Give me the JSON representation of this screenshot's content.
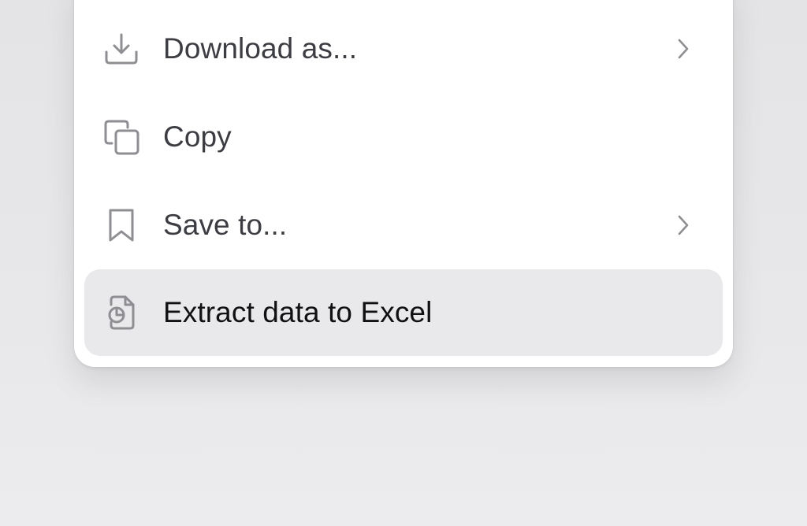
{
  "menu": {
    "items": [
      {
        "label": "Download as...",
        "icon": "download-icon",
        "has_submenu": true,
        "highlighted": false
      },
      {
        "label": "Copy",
        "icon": "copy-icon",
        "has_submenu": false,
        "highlighted": false
      },
      {
        "label": "Save to...",
        "icon": "bookmark-icon",
        "has_submenu": true,
        "highlighted": false
      },
      {
        "label": "Extract data to Excel",
        "icon": "extract-data-icon",
        "has_submenu": false,
        "highlighted": true
      }
    ]
  },
  "colors": {
    "background": "#e6e6e8",
    "menu_background": "#ffffff",
    "highlight": "#e9e9eb",
    "text": "#3c3c43",
    "icon": "#8e8e93"
  }
}
